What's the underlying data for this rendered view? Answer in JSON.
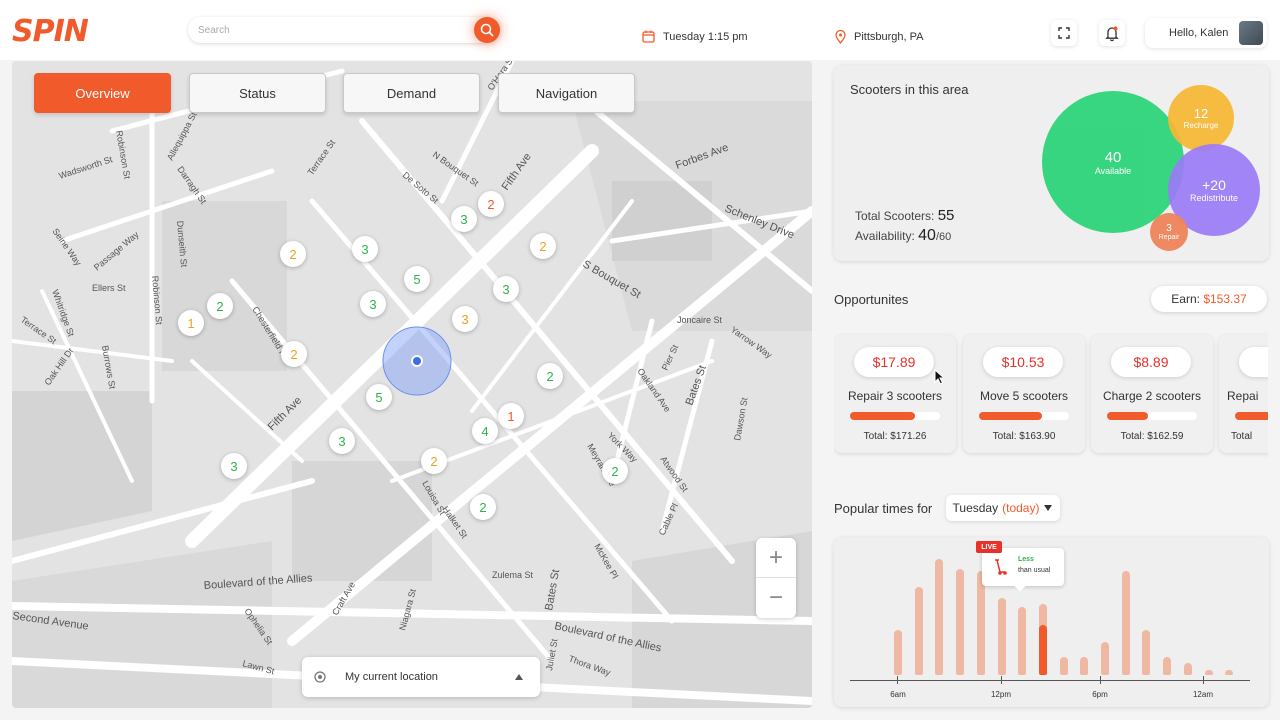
{
  "header": {
    "logo": "SPIN",
    "search_placeholder": "Search",
    "date": "Tuesday 1:15 pm",
    "location": "Pittsburgh, PA",
    "greeting": "Hello, Kalen"
  },
  "tabs": [
    {
      "label": "Overview",
      "active": true
    },
    {
      "label": "Status",
      "active": false
    },
    {
      "label": "Demand",
      "active": false
    },
    {
      "label": "Navigation",
      "active": false
    }
  ],
  "streets": {
    "wadsworth": "Wadsworth St",
    "robinson1": "Robinson St",
    "allequippa": "Allequippa St",
    "darragh": "Darragh St",
    "terrace": "Terrace St",
    "desoto": "De Soto St",
    "nbouquet": "N Bouquet St",
    "ohara": "O'Hara St",
    "fifth1": "Fifth Ave",
    "forbes": "Forbes Ave",
    "schenley": "Schenley Drive",
    "sbouquet": "S Bouquet St",
    "seine": "Seine Way",
    "passage": "Passage Way",
    "ellers": "Ellers St",
    "robinson2": "Robinson St",
    "dunseith": "Dunseith St",
    "whitridge": "Whitridge St",
    "terrace2": "Terrace St",
    "burrows": "Burrows St",
    "oakhill": "Oak Hill Dr",
    "chesterfield": "Chesterfield Rd",
    "fifth2": "Fifth Ave",
    "oakland": "Oakland Ave",
    "bates1": "Bates St",
    "atwood": "Atwood St",
    "dawson": "Dawson St",
    "yarrow": "Yarrow Way",
    "joncaire": "Joncaire St",
    "pier": "Pier St",
    "york": "York Way",
    "meyran": "Meyran Ave",
    "boulevard1": "Boulevard of the Allies",
    "boulevard2": "Boulevard of the Allies",
    "secondave": "Second Avenue",
    "zulema": "Zulema St",
    "ophelia": "Ophelia St",
    "lawn": "Lawn St",
    "mckee": "McKee Pl",
    "cable": "Cable Pl",
    "bates2": "Bates St",
    "niagara": "Niagara St",
    "craft": "Craft Ave",
    "halket": "Halket St",
    "louisa": "Louisa St",
    "juliet": "Juliet St",
    "thora": "Thora Way"
  },
  "markers": [
    {
      "n": "2",
      "color": "#f0a020"
    },
    {
      "n": "3",
      "color": "#2eb34a"
    },
    {
      "n": "2",
      "color": "#f15a2b"
    },
    {
      "n": "3",
      "color": "#2eb34a"
    },
    {
      "n": "2",
      "color": "#f0a020"
    },
    {
      "n": "5",
      "color": "#2eb34a"
    },
    {
      "n": "3",
      "color": "#2eb34a"
    },
    {
      "n": "3",
      "color": "#2eb34a"
    },
    {
      "n": "2",
      "color": "#2eb34a"
    },
    {
      "n": "1",
      "color": "#f0a020"
    },
    {
      "n": "3",
      "color": "#f0a020"
    },
    {
      "n": "2",
      "color": "#f0a020"
    },
    {
      "n": "2",
      "color": "#2eb34a"
    },
    {
      "n": "5",
      "color": "#2eb34a"
    },
    {
      "n": "1",
      "color": "#f15a2b"
    },
    {
      "n": "4",
      "color": "#2eb34a"
    },
    {
      "n": "3",
      "color": "#2eb34a"
    },
    {
      "n": "2",
      "color": "#f0a020"
    },
    {
      "n": "2",
      "color": "#2eb34a"
    },
    {
      "n": "3",
      "color": "#2eb34a"
    },
    {
      "n": "2",
      "color": "#2eb34a"
    }
  ],
  "map_controls": {
    "zoom_in": "+",
    "zoom_out": "−",
    "current_location": "My current location"
  },
  "scooters": {
    "title": "Scooters in this area",
    "total_label": "Total Scooters:",
    "total": "55",
    "availability_label": "Availability:",
    "available_count": "40",
    "availability_max": "/60",
    "bubbles": [
      {
        "value": "40",
        "label": "Available",
        "color": "#2ed47a"
      },
      {
        "value": "12",
        "label": "Recharge",
        "color": "#f7b733"
      },
      {
        "value": "+20",
        "label": "Redistribute",
        "color": "#9b7bf7"
      },
      {
        "value": "3",
        "label": "Repair",
        "color": "#f0845a"
      }
    ]
  },
  "opportunities": {
    "title": "Opportunites",
    "earn_label": "Earn: ",
    "earn_value": "$153.37",
    "items": [
      {
        "price": "$17.89",
        "name": "Repair 3 scooters",
        "progress": 0.72,
        "total": "Total: $171.26"
      },
      {
        "price": "$10.53",
        "name": "Move 5 scooters",
        "progress": 0.7,
        "total": "Total: $163.90"
      },
      {
        "price": "$8.89",
        "name": "Charge 2 scooters",
        "progress": 0.45,
        "total": "Total: $162.59"
      },
      {
        "price": "$",
        "name": "Repai",
        "progress": 0.6,
        "total": "Total"
      }
    ]
  },
  "popular": {
    "title": "Popular times for",
    "day": "Tuesday",
    "day_suffix": "(today)",
    "live": "LIVE",
    "tooltip_strong": "Less",
    "tooltip_rest": "than usual",
    "axis_labels": [
      "6am",
      "12pm",
      "6pm",
      "12am"
    ],
    "bars": [
      0.38,
      0.75,
      0.98,
      0.9,
      0.88,
      0.65,
      0.58,
      0.6,
      0.15,
      0.15,
      0.28,
      0.88,
      0.38,
      0.15,
      0.1,
      0.04,
      0.04
    ],
    "current_index": 7,
    "current_live_fraction": 0.42
  }
}
